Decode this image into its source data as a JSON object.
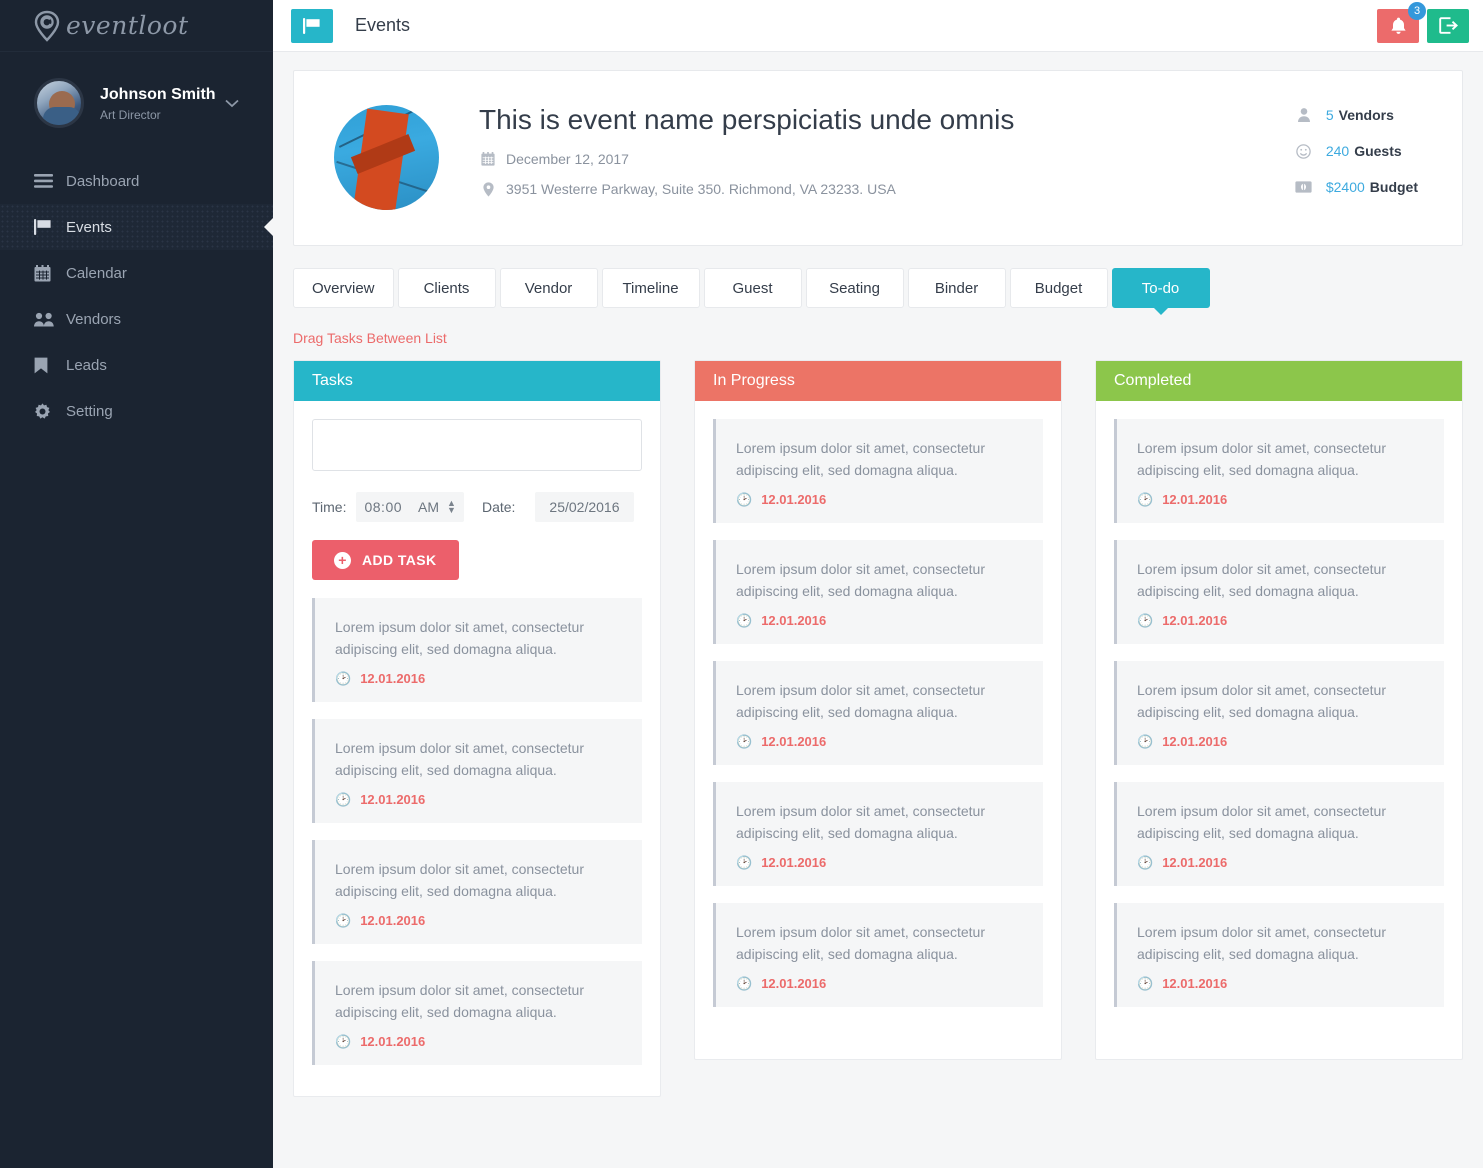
{
  "brand": {
    "name": "eventloot",
    "logo_icon": "location-pin-e-icon"
  },
  "profile": {
    "name": "Johnson Smith",
    "role": "Art Director",
    "caret_icon": "chevron-down-icon",
    "avatar_icon": "user-avatar"
  },
  "sidebar": {
    "items": [
      {
        "label": "Dashboard",
        "icon": "hamburger-icon",
        "active": false
      },
      {
        "label": "Events",
        "icon": "flag-icon",
        "active": true
      },
      {
        "label": "Calendar",
        "icon": "calendar-icon",
        "active": false
      },
      {
        "label": "Vendors",
        "icon": "users-icon",
        "active": false
      },
      {
        "label": "Leads",
        "icon": "bookmark-icon",
        "active": false
      },
      {
        "label": "Setting",
        "icon": "gear-icon",
        "active": false
      }
    ]
  },
  "topbar": {
    "page_icon": "flag-icon",
    "title": "Events",
    "bell_icon": "bell-icon",
    "bell_badge": "3",
    "logout_icon": "logout-icon"
  },
  "event": {
    "thumb_icon": "bridge-photo",
    "title": "This is event name  perspiciatis unde omnis",
    "date_icon": "calendar-icon",
    "date": "December 12, 2017",
    "location_icon": "map-pin-icon",
    "location": "3951 Westerre Parkway, Suite 350. Richmond, VA 23233. USA",
    "stats": [
      {
        "icon": "person-icon",
        "number": "5",
        "label": "Vendors"
      },
      {
        "icon": "smiley-icon",
        "number": "240",
        "label": "Guests"
      },
      {
        "icon": "money-icon",
        "number": "$2400",
        "label": "Budget"
      }
    ]
  },
  "tabs": [
    {
      "label": "Overview",
      "active": false
    },
    {
      "label": "Clients",
      "active": false
    },
    {
      "label": "Vendor",
      "active": false
    },
    {
      "label": "Timeline",
      "active": false
    },
    {
      "label": "Guest",
      "active": false
    },
    {
      "label": "Seating",
      "active": false
    },
    {
      "label": "Binder",
      "active": false
    },
    {
      "label": "Budget",
      "active": false
    },
    {
      "label": "To-do",
      "active": true
    }
  ],
  "todo": {
    "drag_hint": "Drag Tasks Between List",
    "form": {
      "task_value": "",
      "task_placeholder": "",
      "time_label": "Time:",
      "time_value": "08:00",
      "time_ampm": "AM",
      "time_spinner_icon": "spinner-updown-icon",
      "date_label": "Date:",
      "date_value": "25/02/2016",
      "add_button_label": "ADD TASK",
      "add_button_icon": "plus-circle-icon"
    },
    "columns": [
      {
        "title": "Tasks",
        "color": "#26b6c9",
        "has_form": true,
        "cards": [
          {
            "text": "Lorem ipsum dolor sit amet, consectetur adipiscing elit, sed domagna aliqua.",
            "date": "12.01.2016",
            "clock_icon": "clock-icon"
          },
          {
            "text": "Lorem ipsum dolor sit amet, consectetur adipiscing elit, sed domagna aliqua.",
            "date": "12.01.2016",
            "clock_icon": "clock-icon"
          },
          {
            "text": "Lorem ipsum dolor sit amet, consectetur adipiscing elit, sed domagna aliqua.",
            "date": "12.01.2016",
            "clock_icon": "clock-icon"
          },
          {
            "text": "Lorem ipsum dolor sit amet, consectetur adipiscing elit, sed domagna aliqua.",
            "date": "12.01.2016",
            "clock_icon": "clock-icon"
          }
        ]
      },
      {
        "title": "In Progress",
        "color": "#ec7466",
        "has_form": false,
        "cards": [
          {
            "text": "Lorem ipsum dolor sit amet, consectetur adipiscing elit, sed domagna aliqua.",
            "date": "12.01.2016",
            "clock_icon": "clock-icon"
          },
          {
            "text": "Lorem ipsum dolor sit amet, consectetur adipiscing elit, sed domagna aliqua.",
            "date": "12.01.2016",
            "clock_icon": "clock-icon"
          },
          {
            "text": "Lorem ipsum dolor sit amet, consectetur adipiscing elit, sed domagna aliqua.",
            "date": "12.01.2016",
            "clock_icon": "clock-icon"
          },
          {
            "text": "Lorem ipsum dolor sit amet, consectetur adipiscing elit, sed domagna aliqua.",
            "date": "12.01.2016",
            "clock_icon": "clock-icon"
          },
          {
            "text": "Lorem ipsum dolor sit amet, consectetur adipiscing elit, sed domagna aliqua.",
            "date": "12.01.2016",
            "clock_icon": "clock-icon"
          }
        ]
      },
      {
        "title": "Completed",
        "color": "#8cc64b",
        "has_form": false,
        "cards": [
          {
            "text": "Lorem ipsum dolor sit amet, consectetur adipiscing elit, sed domagna aliqua.",
            "date": "12.01.2016",
            "clock_icon": "clock-icon"
          },
          {
            "text": "Lorem ipsum dolor sit amet, consectetur adipiscing elit, sed domagna aliqua.",
            "date": "12.01.2016",
            "clock_icon": "clock-icon"
          },
          {
            "text": "Lorem ipsum dolor sit amet, consectetur adipiscing elit, sed domagna aliqua.",
            "date": "12.01.2016",
            "clock_icon": "clock-icon"
          },
          {
            "text": "Lorem ipsum dolor sit amet, consectetur adipiscing elit, sed domagna aliqua.",
            "date": "12.01.2016",
            "clock_icon": "clock-icon"
          },
          {
            "text": "Lorem ipsum dolor sit amet, consectetur adipiscing elit, sed domagna aliqua.",
            "date": "12.01.2016",
            "clock_icon": "clock-icon"
          }
        ]
      }
    ]
  },
  "colors": {
    "teal": "#26b6c9",
    "salmon": "#ec7466",
    "green": "#8cc64b",
    "red": "#ec6b6b",
    "blue": "#3eaadf",
    "sidebar_bg": "#1b2431"
  }
}
